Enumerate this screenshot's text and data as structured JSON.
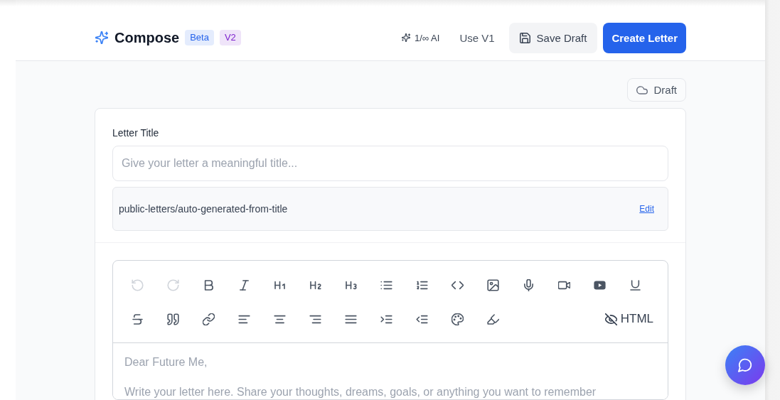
{
  "header": {
    "title": "Compose",
    "badges": [
      {
        "label": "Beta",
        "color": "#2563eb"
      },
      {
        "label": "V2",
        "color": "#7e22ce"
      }
    ],
    "ai_usage": "1/∞ AI",
    "version_link": "Use V1",
    "save_button": "Save Draft",
    "create_button": "Create Letter"
  },
  "status": {
    "label": "Draft"
  },
  "title_field": {
    "label": "Letter Title",
    "placeholder": "Give your letter a meaningful title..."
  },
  "slug": {
    "value": "public-letters/auto-generated-from-title",
    "action": "Edit"
  },
  "editor": {
    "toolbar": {
      "undo": {
        "disabled": true
      },
      "redo": {
        "disabled": true
      },
      "html_toggle": {
        "label": "HTML",
        "on": false
      }
    },
    "placeholder": [
      "Dear Future Me,",
      "Write your letter here. Share your thoughts, dreams, goals, or anything you want to remember"
    ]
  }
}
